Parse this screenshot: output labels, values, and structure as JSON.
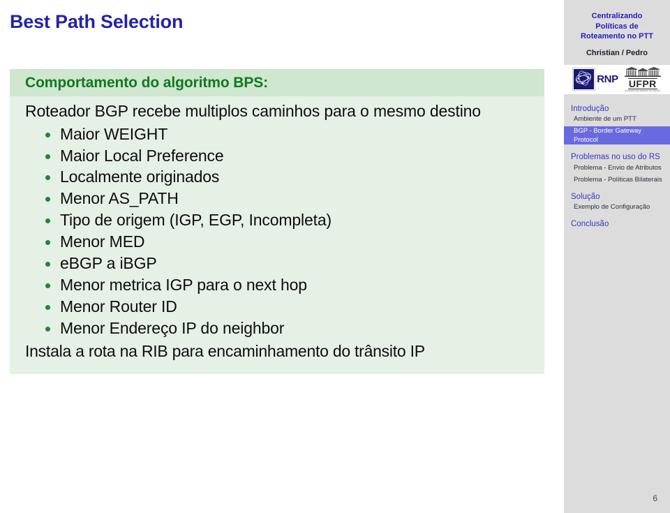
{
  "slide": {
    "title": "Best Path Selection",
    "page_number": "6",
    "block": {
      "header": "Comportamento do algoritmo BPS:",
      "lead": "Roteador BGP recebe multiplos caminhos para o mesmo destino",
      "bullets": [
        "Maior WEIGHT",
        "Maior Local Preference",
        "Localmente originados",
        "Menor AS_PATH",
        "Tipo de origem (IGP, EGP, Incompleta)",
        "Menor MED",
        "eBGP a iBGP",
        "Menor metrica IGP para o next hop",
        "Menor Router ID",
        "Menor Endereço IP do neighbor"
      ],
      "tail": "Instala a rota na RIB para encaminhamento do trânsito IP"
    }
  },
  "sidebar": {
    "deck_title_line1": "Centralizando",
    "deck_title_line2": "Políticas de",
    "deck_title_line3": "Roteamento no PTT",
    "authors": "Christian / Pedro",
    "logos": {
      "rnp_label": "RNP",
      "ufpr_label": "UFPR",
      "ufpr_subtitle": "UNIVERSIDADE FEDERAL DO PARANÁ"
    },
    "nav": [
      {
        "type": "section",
        "label": "Introdução",
        "active": false
      },
      {
        "type": "sub",
        "label": "Ambiente de um PTT",
        "active": false
      },
      {
        "type": "sub",
        "label": "BGP - Border Gateway Protocol",
        "active": true
      },
      {
        "type": "section",
        "label": "Problemas no uso do RS",
        "active": false
      },
      {
        "type": "sub",
        "label": "Problema - Envio de Atributos",
        "active": false
      },
      {
        "type": "sub",
        "label": "Problema - Políticas Bilaterais",
        "active": false
      },
      {
        "type": "section",
        "label": "Solução",
        "active": false
      },
      {
        "type": "sub",
        "label": "Exemplo de Configuração",
        "active": false
      },
      {
        "type": "section",
        "label": "Conclusão",
        "active": false
      }
    ]
  },
  "colors": {
    "title_blue": "#2323ad",
    "header_green_text": "#0f7a1e",
    "header_green_bg": "#cfe6cf",
    "body_green_bg": "#e6f1e6",
    "bullet_green": "#1a8a2a",
    "nav_link_blue": "#3737c9",
    "nav_active_bg": "#6a6ae0",
    "sidebar_bg": "#dcdcdc",
    "logo_navy": "#191970"
  }
}
